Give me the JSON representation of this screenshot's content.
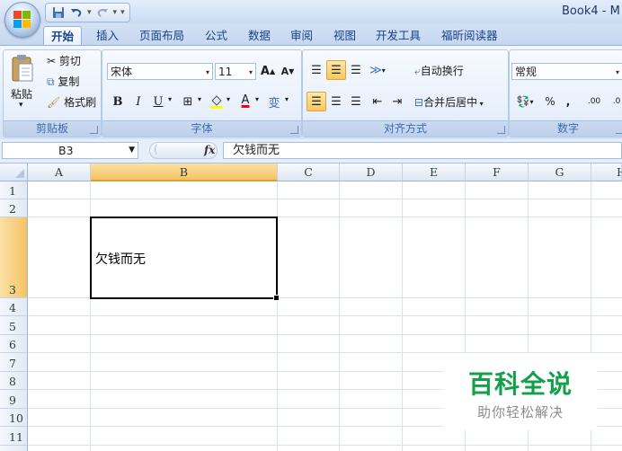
{
  "window": {
    "title": "Book4 - M"
  },
  "tabs": [
    {
      "label": "开始",
      "active": true
    },
    {
      "label": "插入"
    },
    {
      "label": "页面布局"
    },
    {
      "label": "公式"
    },
    {
      "label": "数据"
    },
    {
      "label": "审阅"
    },
    {
      "label": "视图"
    },
    {
      "label": "开发工具"
    },
    {
      "label": "福昕阅读器"
    }
  ],
  "ribbon": {
    "clipboard": {
      "paste": "粘贴",
      "cut": "剪切",
      "copy": "复制",
      "format_painter": "格式刷",
      "label": "剪贴板"
    },
    "font": {
      "name": "宋体",
      "size": "11",
      "grow": "A",
      "shrink": "A",
      "bold": "B",
      "italic": "I",
      "underline": "U",
      "font_color_letter": "A",
      "phonetic": "变",
      "label": "字体"
    },
    "alignment": {
      "wrap_text": "自动换行",
      "merge_center": "合并后居中",
      "label": "对齐方式"
    },
    "number": {
      "format": "常规",
      "percent": "%",
      "comma": ",",
      "increase_decimal": ".00",
      "label": "数字"
    }
  },
  "formula_bar": {
    "name_box": "B3",
    "fx": "fx",
    "content": "欠钱而无"
  },
  "sheet": {
    "columns": [
      "A",
      "B",
      "C",
      "D",
      "E",
      "F",
      "G",
      "H"
    ],
    "rows": [
      "1",
      "2",
      "3",
      "4",
      "5",
      "6",
      "7",
      "8",
      "9",
      "10",
      "11"
    ],
    "selected_column": "B",
    "selected_row": "3",
    "cells": {
      "B3": "欠钱而无"
    }
  },
  "watermark": {
    "title": "百科全说",
    "subtitle": "助你轻松解决"
  },
  "colors": {
    "accent_orange": "#f6c263",
    "ribbon_blue": "#15428b",
    "watermark_green": "#12a14a"
  }
}
